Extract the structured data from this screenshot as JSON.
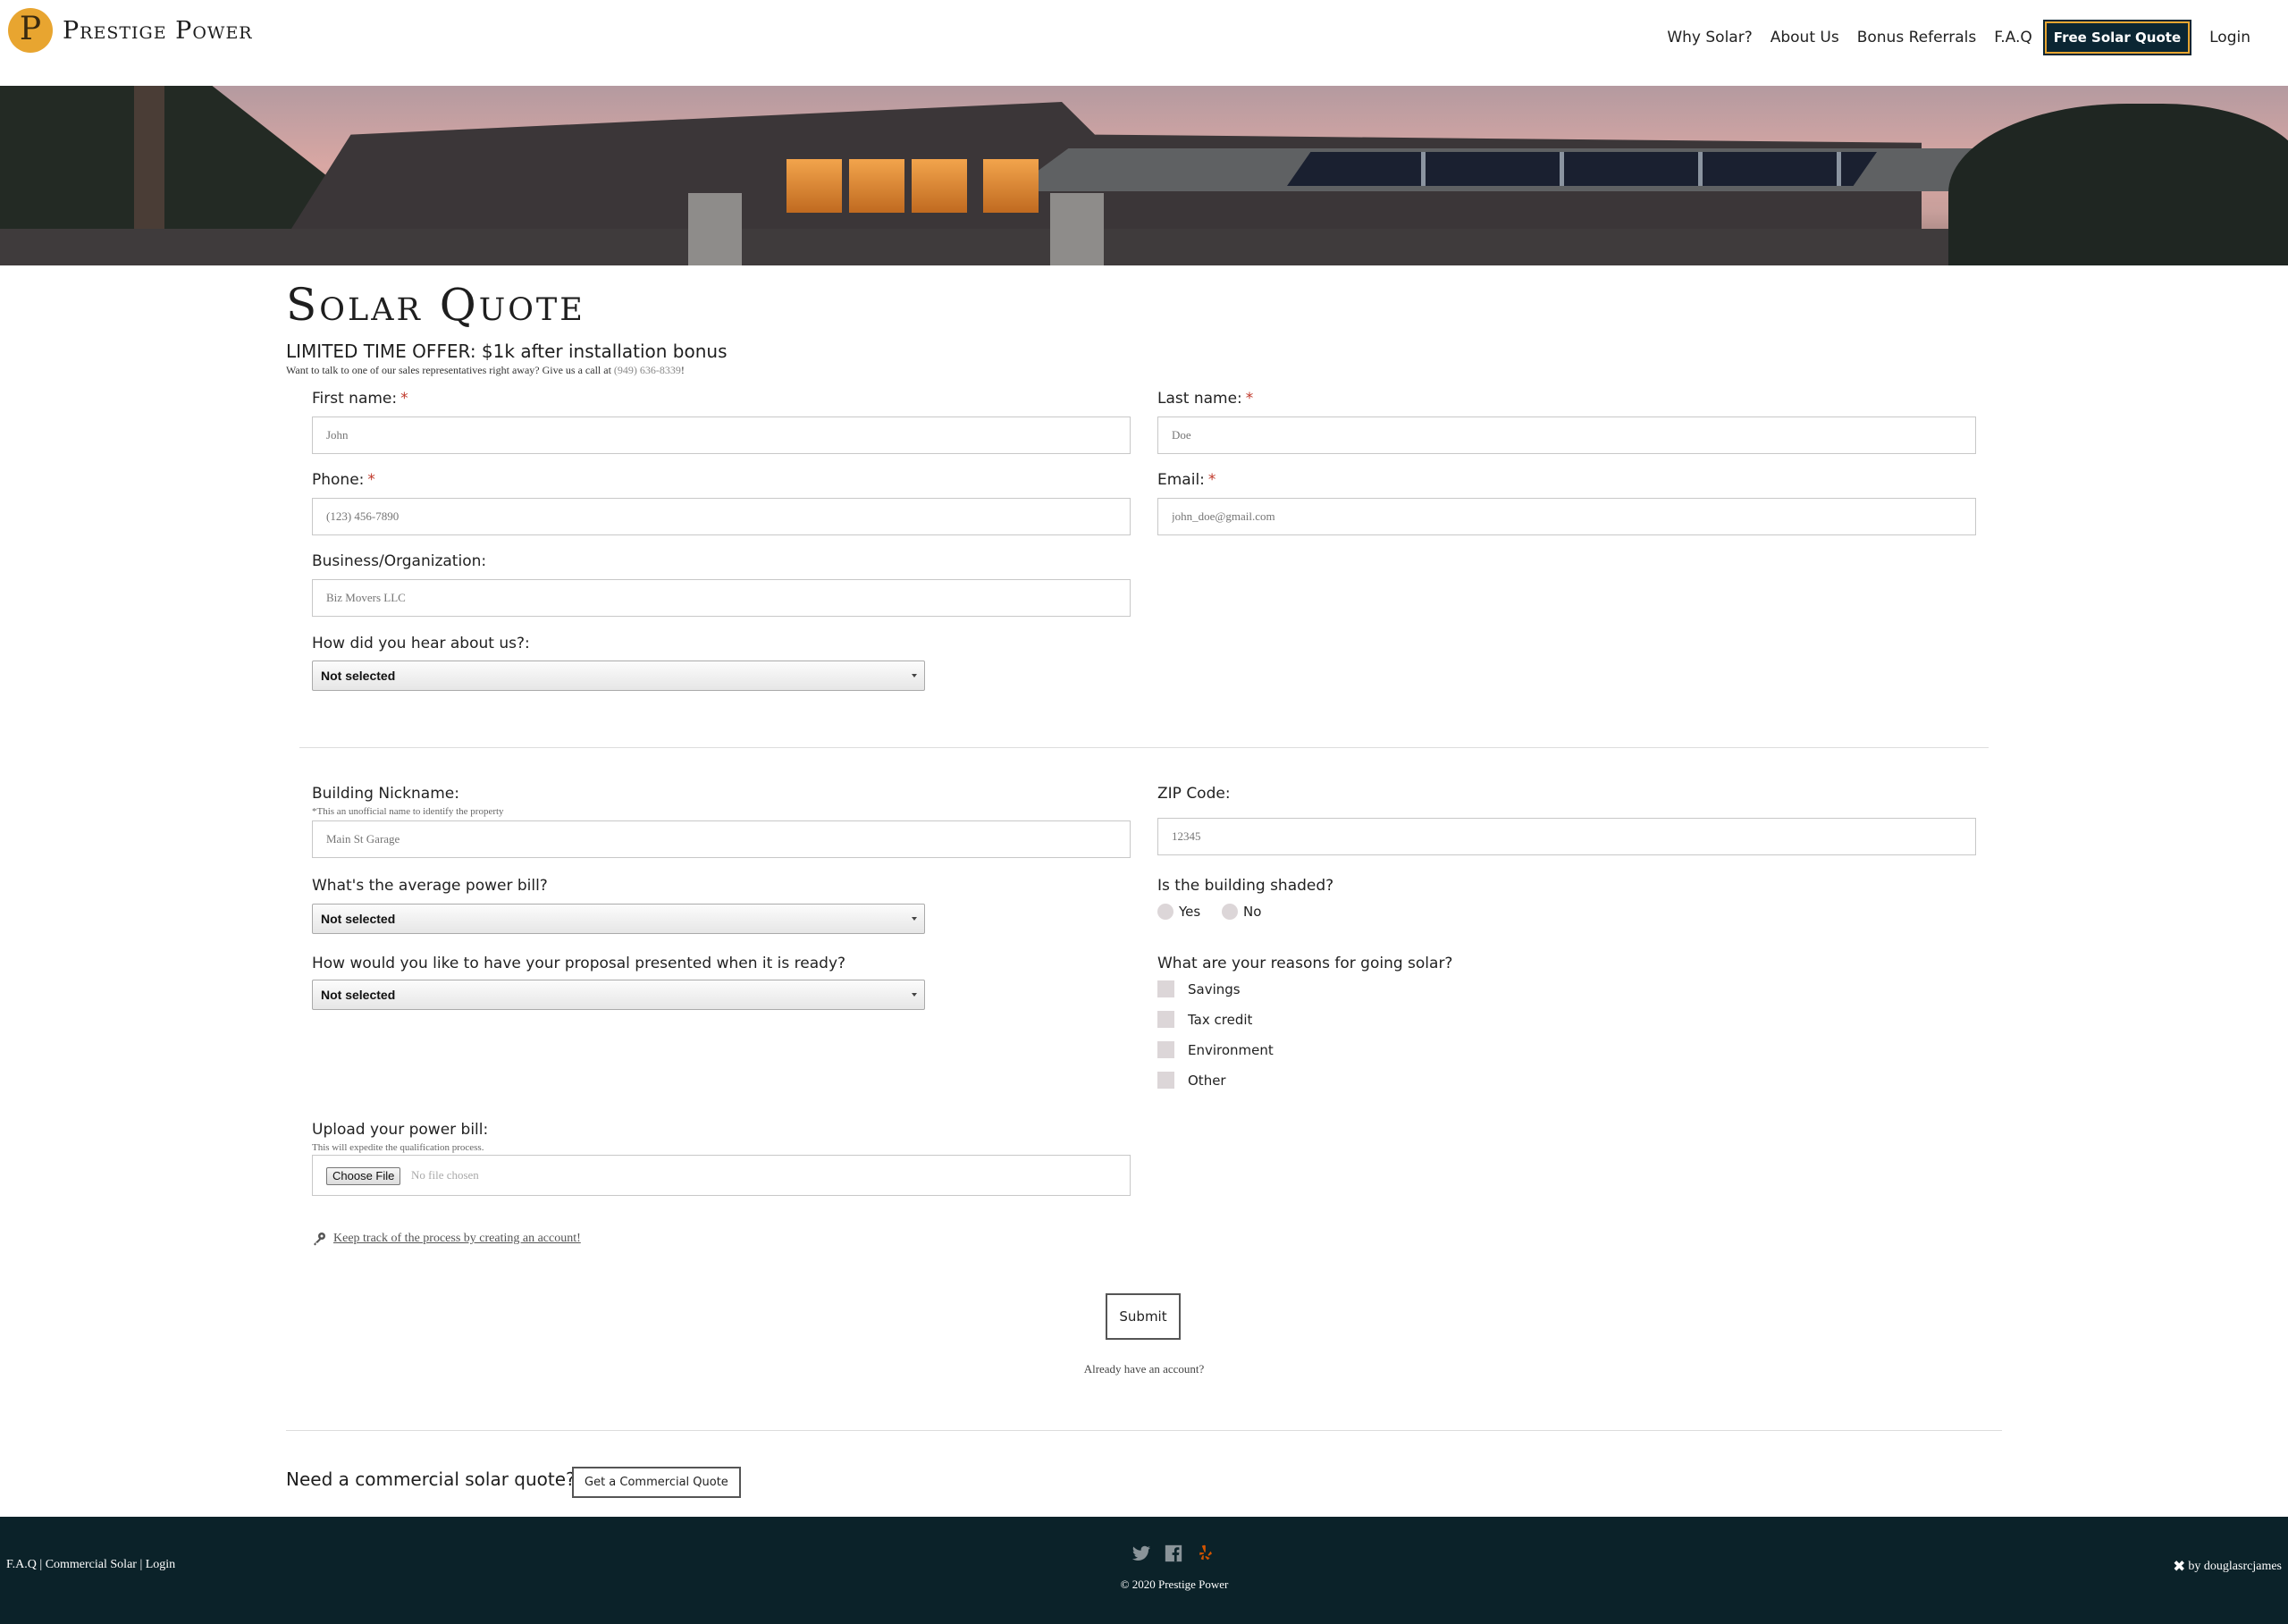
{
  "nav": {
    "brand": "Prestige Power",
    "links": [
      "Why Solar?",
      "About Us",
      "Bonus Referrals",
      "F.A.Q"
    ],
    "cta": "Free Solar Quote",
    "login": "Login"
  },
  "page": {
    "title": "Solar Quote",
    "offer": "LIMITED TIME OFFER: $1k after installation bonus",
    "call_prefix": "Want to talk to one of our sales representatives right away? Give us a call at",
    "phone": "(949) 636-8339",
    "call_suffix": "!"
  },
  "form": {
    "first_name": {
      "label": "First name:",
      "required": "*",
      "placeholder": "John"
    },
    "last_name": {
      "label": "Last name:",
      "required": "*",
      "placeholder": "Doe"
    },
    "phone": {
      "label": "Phone:",
      "required": "*",
      "placeholder": "(123) 456-7890"
    },
    "email": {
      "label": "Email:",
      "required": "*",
      "placeholder": "john_doe@gmail.com"
    },
    "business": {
      "label": "Business/Organization:",
      "placeholder": "Biz Movers LLC"
    },
    "hear_about": {
      "label": "How did you hear about us?:",
      "value": "Not selected"
    },
    "building_nickname": {
      "label": "Building Nickname:",
      "hint": "*This an unofficial name to identify the property",
      "placeholder": "Main St Garage"
    },
    "zip": {
      "label": "ZIP Code:",
      "placeholder": "12345"
    },
    "power_bill": {
      "label": "What's the average power bill?",
      "value": "Not selected"
    },
    "shaded": {
      "label": "Is the building shaded?",
      "options": [
        "Yes",
        "No"
      ]
    },
    "proposal": {
      "label": "How would you like to have your proposal presented when it is ready?",
      "value": "Not selected"
    },
    "reasons": {
      "label": "What are your reasons for going solar?",
      "options": [
        "Savings",
        "Tax credit",
        "Environment",
        "Other"
      ]
    },
    "upload": {
      "label": "Upload your power bill:",
      "hint": "This will expedite the qualification process.",
      "button": "Choose File",
      "status": "No file chosen"
    },
    "account_link": "Keep track of the process by creating an account!",
    "submit": "Submit",
    "already": "Already have an account?"
  },
  "commercial": {
    "question": "Need a commercial solar quote?",
    "button": "Get a Commercial Quote"
  },
  "footer": {
    "links": "F.A.Q | Commercial Solar | Login",
    "copyright": "© 2020 Prestige Power",
    "credit": "by douglasrcjames",
    "social": [
      "twitter-icon",
      "facebook-icon",
      "yelp-icon"
    ]
  },
  "colors": {
    "footer_bg": "#0b2229",
    "cta_bg": "#0b2633",
    "accent": "#e8a530",
    "required": "#c0392b",
    "yelp": "#d35400"
  }
}
